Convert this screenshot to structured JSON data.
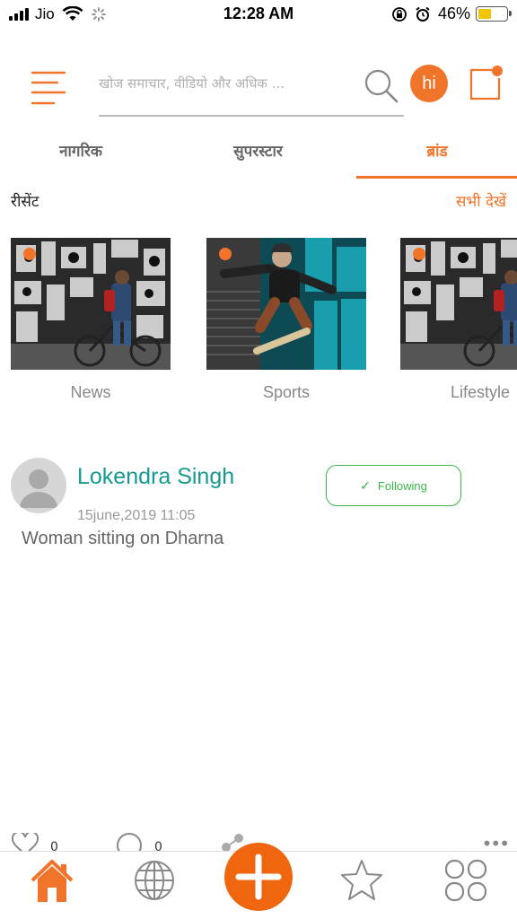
{
  "status_bar": {
    "carrier": "Jio",
    "time": "12:28 AM",
    "battery": "46%",
    "battery_level": 0.46
  },
  "header": {
    "search_placeholder": "खोज समाचार, वीडियो और अधिक ...",
    "avatar_text": "hi"
  },
  "tabs": [
    {
      "label": "नागरिक"
    },
    {
      "label": "सुपरस्टार"
    },
    {
      "label": "ब्रांड",
      "active": true
    }
  ],
  "recent": {
    "title": "रीसेंट",
    "see_all": "सभी देखें",
    "cards": [
      {
        "label": "News"
      },
      {
        "label": "Sports"
      },
      {
        "label": "Lifestyle"
      }
    ]
  },
  "post": {
    "author": "Lokendra Singh",
    "follow_label": "Following",
    "date": "15june,2019 11:05",
    "text": "Woman sitting on Dharna",
    "likes": "0",
    "comments": "0"
  },
  "colors": {
    "accent": "#f0752b",
    "teal": "#149a93",
    "follow_green": "#3bb54a"
  },
  "bottom_nav": [
    {
      "icon": "home-icon",
      "active": true
    },
    {
      "icon": "globe-icon"
    },
    {
      "icon": "plus-icon"
    },
    {
      "icon": "star-icon"
    },
    {
      "icon": "grid-icon"
    }
  ]
}
